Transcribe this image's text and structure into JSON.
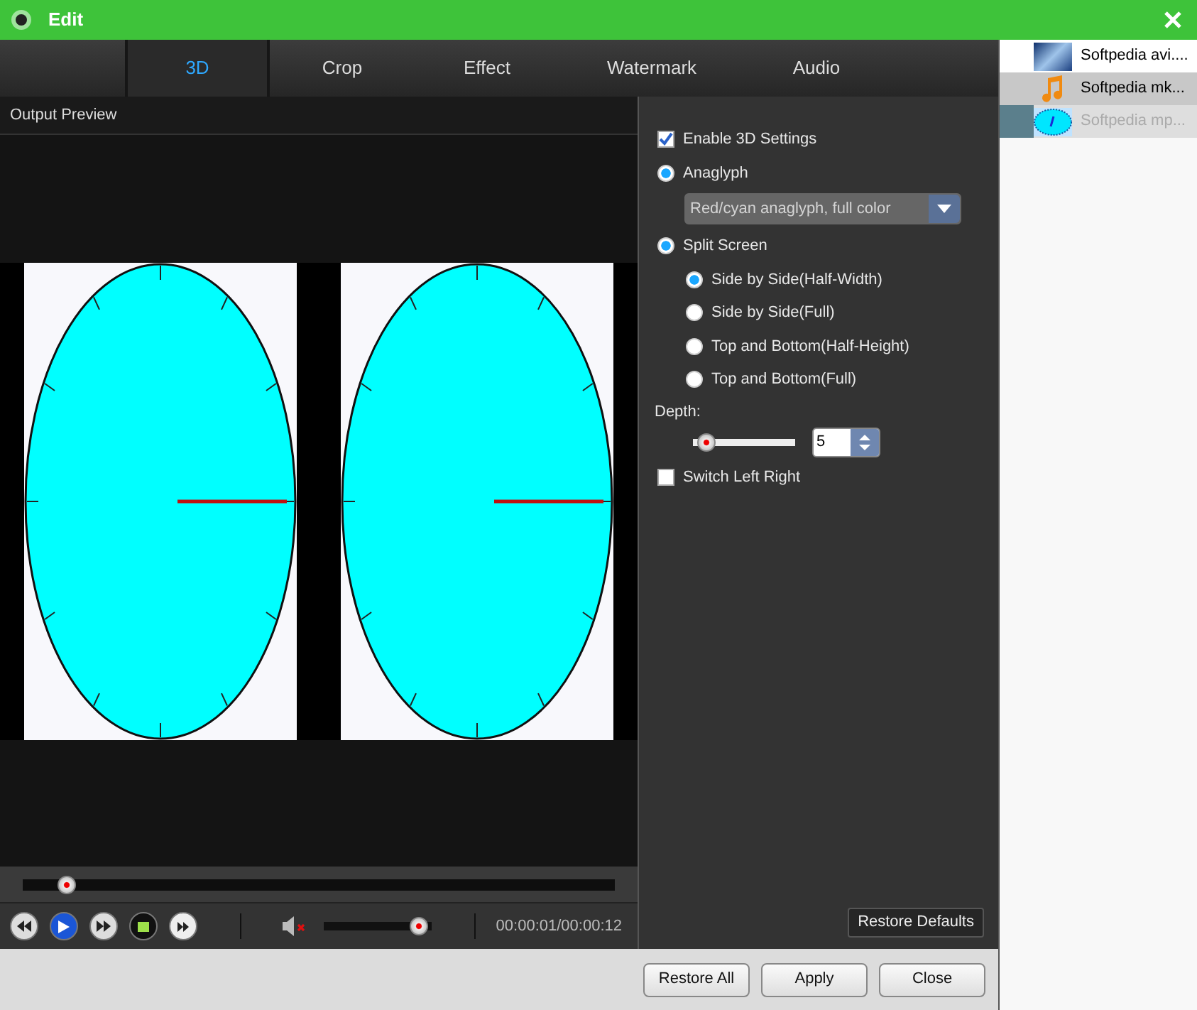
{
  "window": {
    "title": "Edit"
  },
  "tabs": [
    {
      "label": "3D",
      "selected": true
    },
    {
      "label": "Crop",
      "selected": false
    },
    {
      "label": "Effect",
      "selected": false
    },
    {
      "label": "Watermark",
      "selected": false
    },
    {
      "label": "Audio",
      "selected": false
    }
  ],
  "preview": {
    "title": "Output Preview",
    "seek": {
      "level": 0.075
    },
    "volume": {
      "level": 0.88,
      "muted": true
    },
    "time": "00:00:01/00:00:12"
  },
  "settings": {
    "enable_3d": {
      "label": "Enable 3D Settings",
      "checked": true
    },
    "modes": [
      {
        "label": "Anaglyph",
        "selected": true
      },
      {
        "label": "Split Screen",
        "selected": true
      }
    ],
    "anaglyph_dropdown": {
      "value": "Red/cyan anaglyph, full color",
      "disabled": true
    },
    "split_options": [
      {
        "label": "Side by Side(Half-Width)",
        "selected": true
      },
      {
        "label": "Side by Side(Full)",
        "selected": false
      },
      {
        "label": "Top and Bottom(Half-Height)",
        "selected": false
      },
      {
        "label": "Top and Bottom(Full)",
        "selected": false
      }
    ],
    "depth": {
      "label": "Depth:",
      "level": 0.05,
      "value": "5"
    },
    "switch_left_right": {
      "label": "Switch Left Right",
      "checked": false
    },
    "restore_defaults": "Restore Defaults"
  },
  "buttons": [
    "Restore All",
    "Apply",
    "Close"
  ],
  "files": [
    {
      "name": "Softpedia avi....",
      "kind": "video",
      "selected": false,
      "disabled": false
    },
    {
      "name": "Softpedia mk...",
      "kind": "audio",
      "selected": true,
      "disabled": false
    },
    {
      "name": "Softpedia mp...",
      "kind": "clock",
      "selected": false,
      "disabled": true
    }
  ]
}
